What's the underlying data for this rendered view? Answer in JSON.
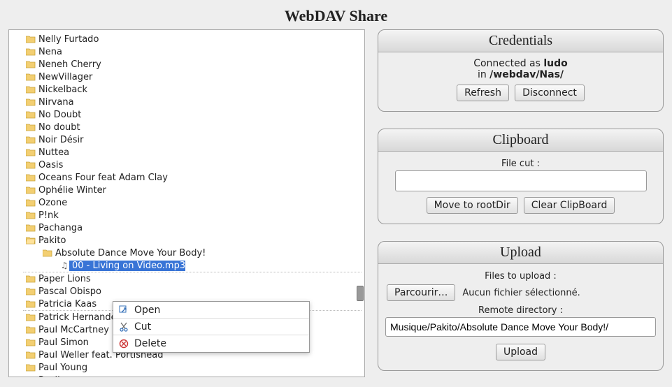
{
  "title": "WebDAV Share",
  "tree": {
    "items": [
      {
        "label": "Nelly Furtado",
        "type": "folder"
      },
      {
        "label": "Nena",
        "type": "folder"
      },
      {
        "label": "Neneh Cherry",
        "type": "folder"
      },
      {
        "label": "NewVillager",
        "type": "folder"
      },
      {
        "label": "Nickelback",
        "type": "folder"
      },
      {
        "label": "Nirvana",
        "type": "folder"
      },
      {
        "label": "No Doubt",
        "type": "folder"
      },
      {
        "label": "No doubt",
        "type": "folder"
      },
      {
        "label": "Noir Désir",
        "type": "folder"
      },
      {
        "label": "Nuttea",
        "type": "folder"
      },
      {
        "label": "Oasis",
        "type": "folder"
      },
      {
        "label": "Oceans Four feat Adam Clay",
        "type": "folder"
      },
      {
        "label": "Ophélie Winter",
        "type": "folder"
      },
      {
        "label": "Ozone",
        "type": "folder"
      },
      {
        "label": "P!nk",
        "type": "folder"
      },
      {
        "label": "Pachanga",
        "type": "folder"
      },
      {
        "label": "Pakito",
        "type": "folder",
        "open": true
      },
      {
        "label": "Absolute Dance Move Your Body!",
        "type": "folder",
        "indent": 1
      },
      {
        "label": "00 - Living on Video.mp3",
        "type": "file",
        "indent": 2,
        "selected": true
      },
      {
        "label": "Paper Lions",
        "type": "folder",
        "dashed": true
      },
      {
        "label": "Pascal Obispo",
        "type": "folder"
      },
      {
        "label": "Patricia Kaas",
        "type": "folder"
      },
      {
        "label": "Patrick Hernande",
        "type": "folder",
        "dashed": true
      },
      {
        "label": "Paul McCartney",
        "type": "folder"
      },
      {
        "label": "Paul Simon",
        "type": "folder"
      },
      {
        "label": "Paul Weller feat. Portishead",
        "type": "folder"
      },
      {
        "label": "Paul Young",
        "type": "folder"
      },
      {
        "label": "Pauline",
        "type": "folder"
      }
    ]
  },
  "context_menu": {
    "items": [
      {
        "label": "Open",
        "icon": "open"
      },
      {
        "label": "Cut",
        "icon": "cut"
      },
      {
        "label": "Delete",
        "icon": "delete"
      }
    ]
  },
  "credentials": {
    "title": "Credentials",
    "connected_as_prefix": "Connected as ",
    "user": "ludo",
    "in_prefix": "in ",
    "path": "/webdav/Nas/",
    "refresh": "Refresh",
    "disconnect": "Disconnect"
  },
  "clipboard": {
    "title": "Clipboard",
    "file_cut_label": "File cut :",
    "value": "",
    "move_root": "Move to rootDir",
    "clear": "Clear ClipBoard"
  },
  "upload": {
    "title": "Upload",
    "files_label": "Files to upload :",
    "browse": "Parcourir…",
    "no_file": "Aucun fichier sélectionné.",
    "remote_label": "Remote directory :",
    "remote_value": "Musique/Pakito/Absolute Dance Move Your Body!/",
    "upload_btn": "Upload"
  }
}
